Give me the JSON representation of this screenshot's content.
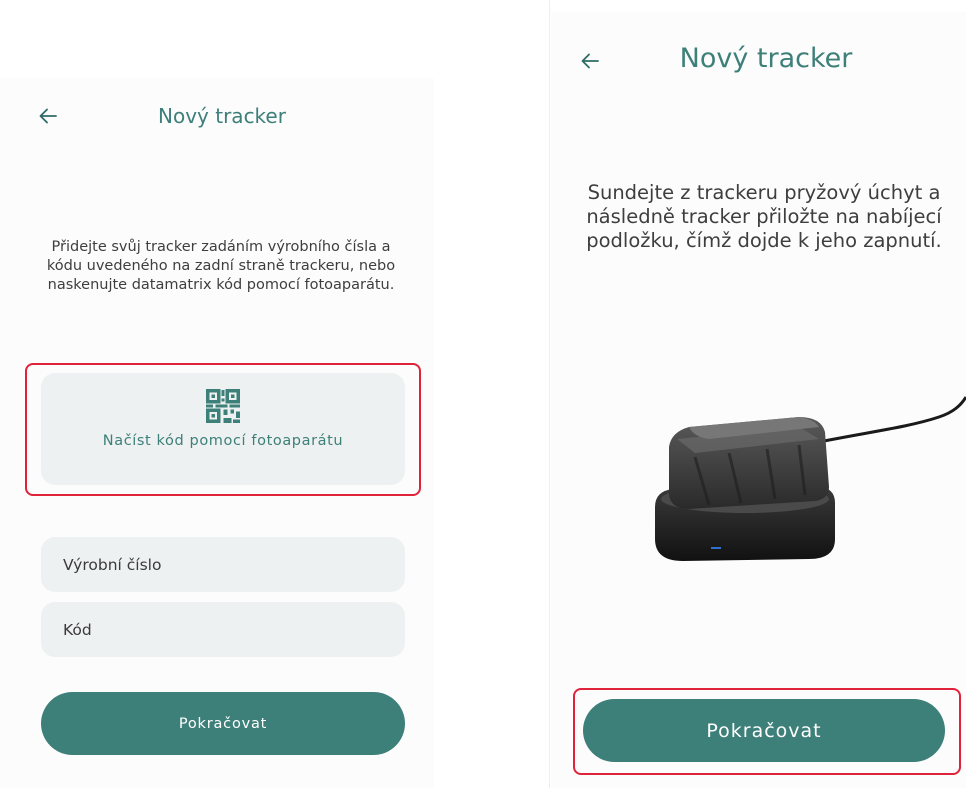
{
  "left": {
    "header": {
      "back_icon": "arrow-left-icon",
      "title": "Nový tracker"
    },
    "description": "Přidejte svůj tracker zadáním výrobního čísla a kódu uvedeného na zadní straně trackeru, nebo naskenujte datamatrix kód pomocí fotoaparátu.",
    "scan_card": {
      "icon": "qr-code-icon",
      "label": "Načíst kód pomocí fotoaparátu"
    },
    "fields": {
      "serial_placeholder": "Výrobní číslo",
      "code_placeholder": "Kód"
    },
    "continue_label": "Pokračovat"
  },
  "right": {
    "header": {
      "back_icon": "arrow-left-icon",
      "title": "Nový tracker"
    },
    "description": "Sundejte z trackeru pryžový úchyt a následně tracker přiložte na nabíjecí podložku, čímž dojde k jeho zapnutí.",
    "image": "tracker-on-charging-pad",
    "continue_label": "Pokračovat"
  },
  "colors": {
    "accent": "#3d7f79",
    "field_bg": "#eef1f1",
    "highlight": "#e0223a"
  }
}
